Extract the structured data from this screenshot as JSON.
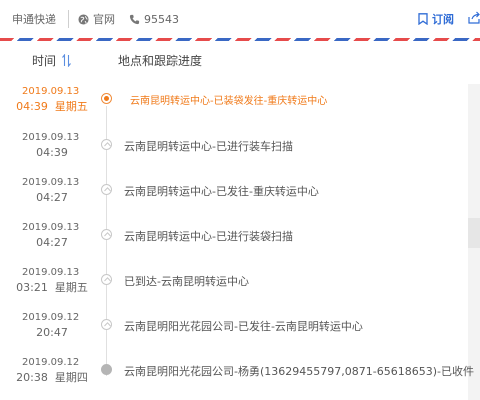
{
  "header": {
    "carrier": "申通快递",
    "website_label": "官网",
    "phone": "95543",
    "subscribe_label": "订阅"
  },
  "columns": {
    "time_label": "时间",
    "progress_label": "地点和跟踪进度"
  },
  "events": [
    {
      "date": "2019.09.13",
      "time": "04:39  星期五",
      "desc": "云南昆明转运中心-已装袋发往-重庆转运中心",
      "status": "current"
    },
    {
      "date": "2019.09.13",
      "time": "04:39",
      "desc": "云南昆明转运中心-已进行装车扫描",
      "status": "past"
    },
    {
      "date": "2019.09.13",
      "time": "04:27",
      "desc": "云南昆明转运中心-已发往-重庆转运中心",
      "status": "past"
    },
    {
      "date": "2019.09.13",
      "time": "04:27",
      "desc": "云南昆明转运中心-已进行装袋扫描",
      "status": "past"
    },
    {
      "date": "2019.09.13",
      "time": "03:21  星期五",
      "desc": "已到达-云南昆明转运中心",
      "status": "past"
    },
    {
      "date": "2019.09.12",
      "time": "20:47",
      "desc": "云南昆明阳光花园公司-已发往-云南昆明转运中心",
      "status": "past"
    },
    {
      "date": "2019.09.12",
      "time": "20:38  星期四",
      "desc": "云南昆明阳光花园公司-杨勇(13629455797,0871-65618653)-已收件",
      "status": "start"
    }
  ],
  "colors": {
    "accent_orange": "#f07a1a",
    "link_blue": "#2f6cd6",
    "stripe_red": "#e64b4b",
    "stripe_blue": "#3a68c4"
  },
  "icons": {
    "website": "globe-icon",
    "phone": "phone-icon",
    "subscribe": "bookmark-icon",
    "share": "share-icon",
    "sort": "sort-icon",
    "node": "chevron-up-icon"
  }
}
